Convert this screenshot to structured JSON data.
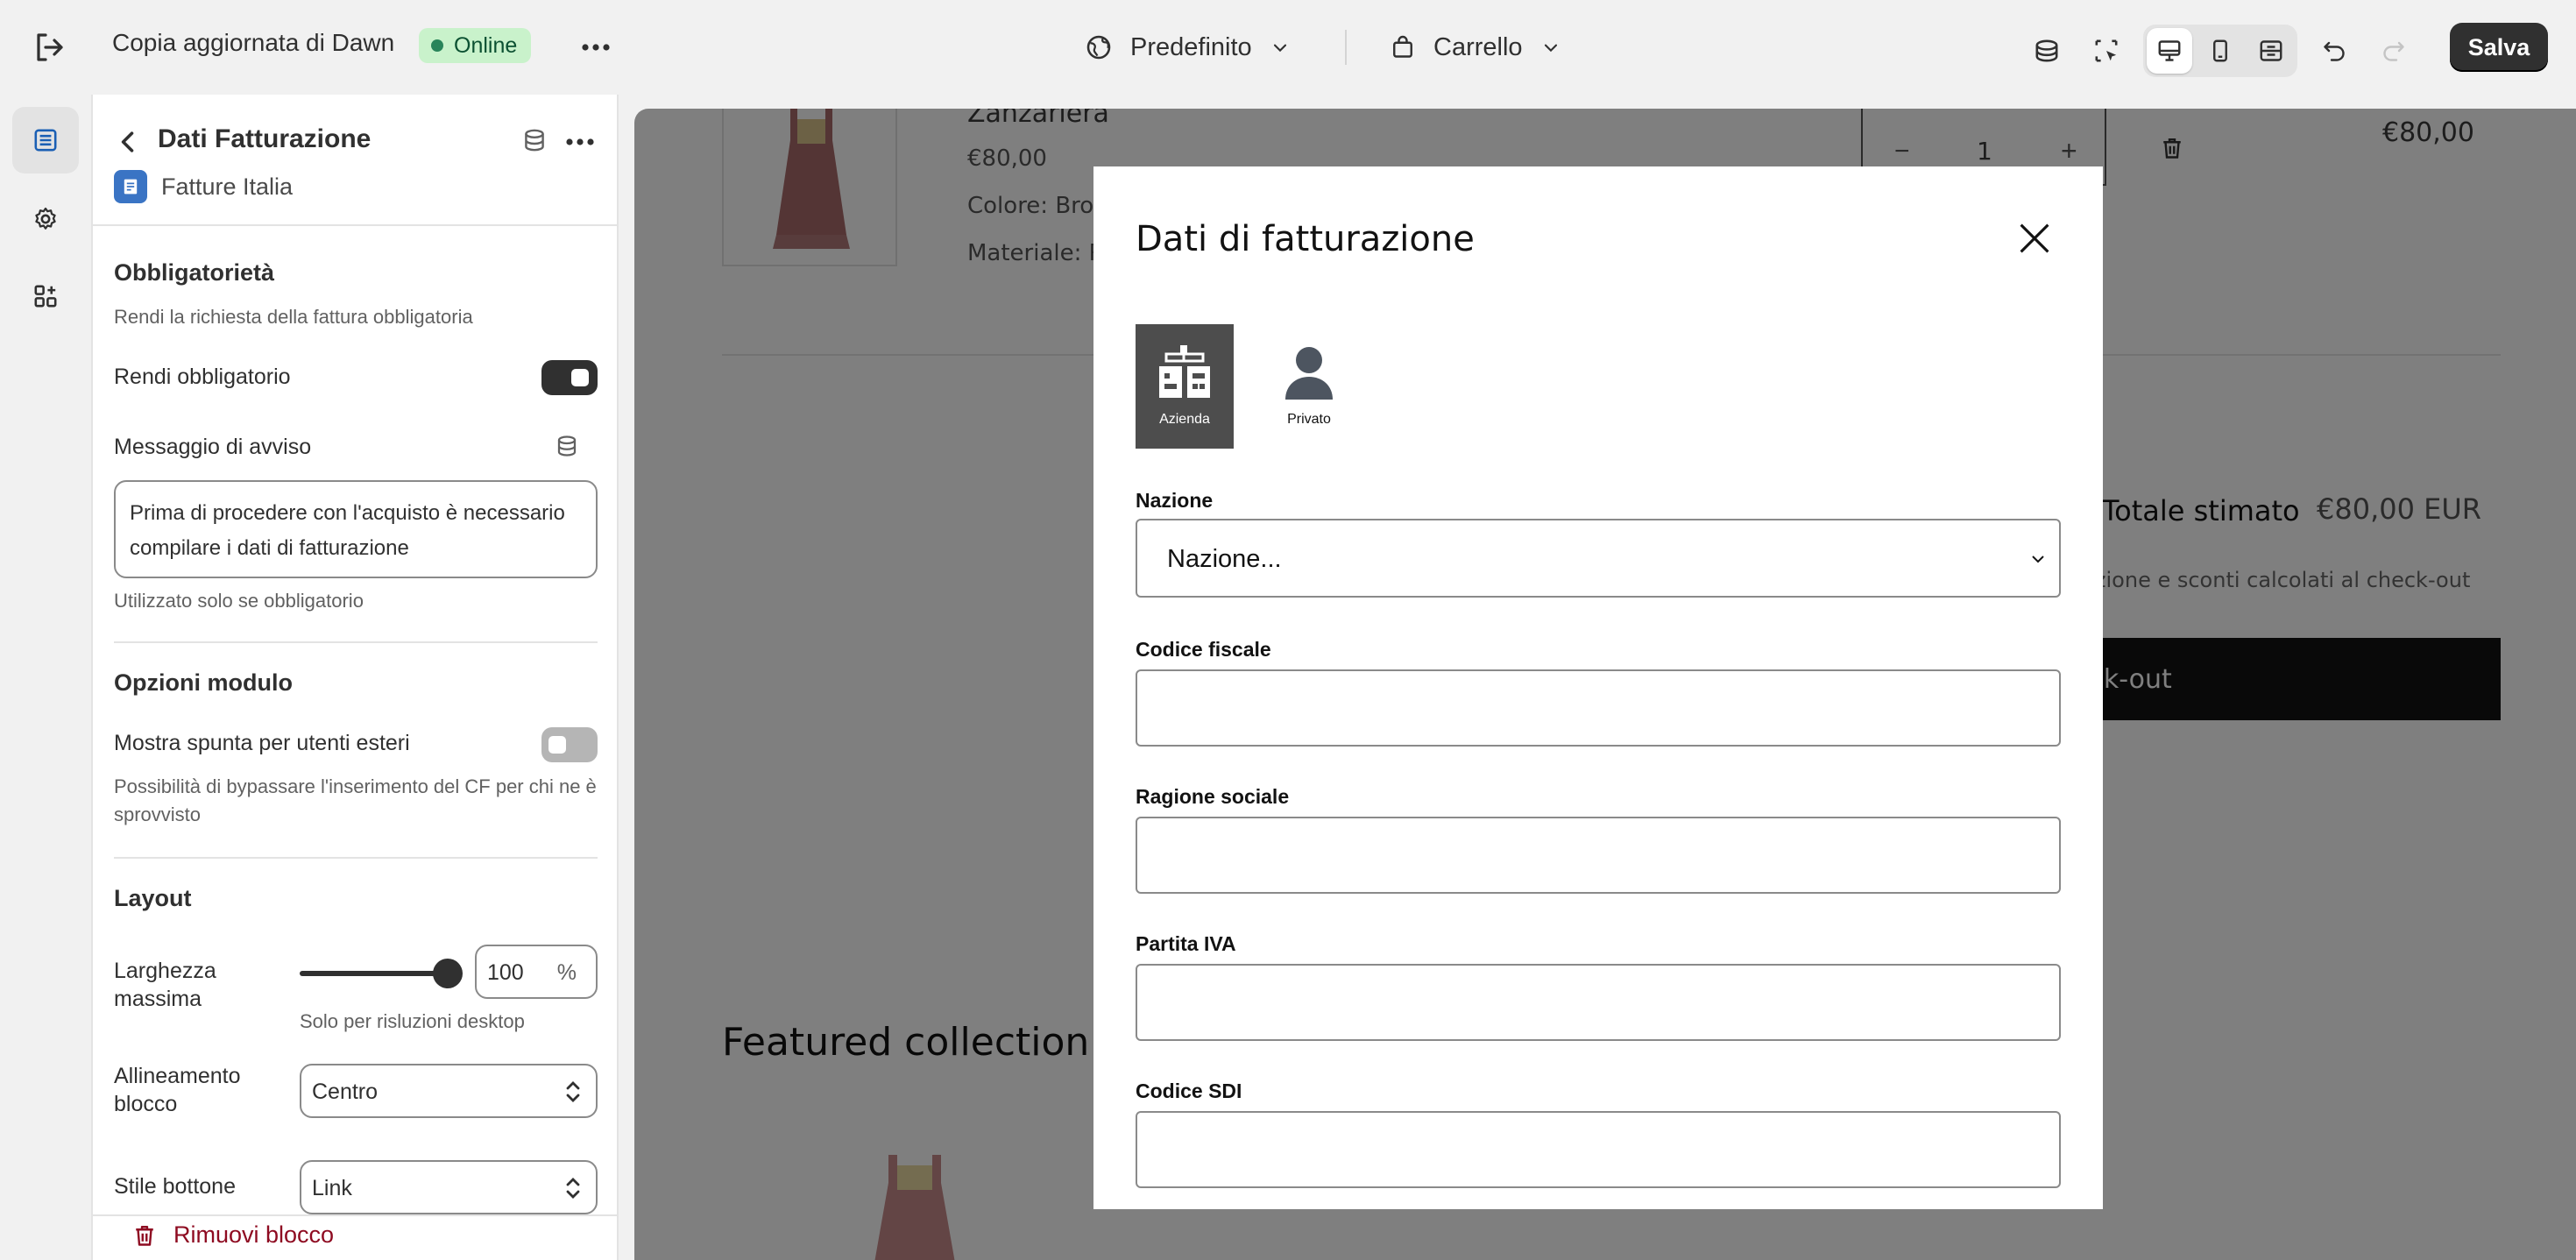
{
  "topbar": {
    "title": "Copia aggiornata di Dawn",
    "status": "Online",
    "theme_selector": "Predefinito",
    "page_selector": "Carrello",
    "save_label": "Salva"
  },
  "sidebar": {
    "title": "Dati Fatturazione",
    "app_name": "Fatture Italia",
    "section_required": {
      "title": "Obbligatorietà",
      "description": "Rendi la richiesta della fattura obbligatoria",
      "toggle_label": "Rendi obbligatorio",
      "toggle_on": true,
      "message_label": "Messaggio di avviso",
      "message_value": "Prima di procedere con l'acquisto è necessario compilare i dati di fatturazione",
      "message_help": "Utilizzato solo se obbligatorio"
    },
    "section_options": {
      "title": "Opzioni modulo",
      "toggle_label": "Mostra spunta per utenti esteri",
      "toggle_on": false,
      "help": "Possibilità di bypassare l'inserimento del CF per chi ne è sprovvisto"
    },
    "section_layout": {
      "title": "Layout",
      "max_width_label": "Larghezza massima",
      "max_width_value": "100",
      "max_width_unit": "%",
      "max_width_help": "Solo per risluzioni desktop",
      "align_label": "Allineamento blocco",
      "align_value": "Centro",
      "button_style_label": "Stile bottone",
      "button_style_value": "Link"
    },
    "remove_label": "Rimuovi blocco"
  },
  "preview": {
    "product_name": "Zanzariera",
    "product_price": "€80,00",
    "product_color": "Colore: Bro",
    "product_material": "Materiale: R",
    "quantity": "1",
    "line_total": "€80,00",
    "total_label": "Totale stimato",
    "total_value": "€80,00 EUR",
    "tax_note": "dizione e sconti calcolati al check-out",
    "checkout_label": "Check-out",
    "featured_title": "Featured collection"
  },
  "modal": {
    "title": "Dati di fatturazione",
    "types": [
      {
        "label": "Azienda",
        "active": true
      },
      {
        "label": "Privato",
        "active": false
      }
    ],
    "country_label": "Nazione",
    "country_placeholder": "Nazione...",
    "tax_code_label": "Codice fiscale",
    "company_label": "Ragione sociale",
    "vat_label": "Partita IVA",
    "sdi_label": "Codice SDI"
  },
  "colors": {
    "accent_dark": "#303030",
    "online_badge_bg": "#c9f2cb",
    "online_badge_text": "#0c5132",
    "danger": "#8e0b21",
    "app_icon": "#3a74c4"
  }
}
